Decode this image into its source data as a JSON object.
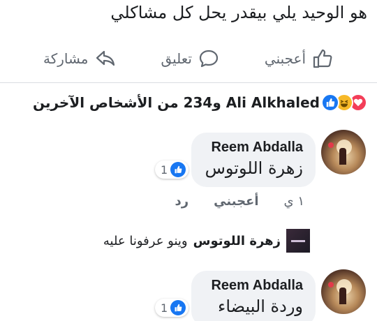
{
  "post": {
    "text": "هو الوحيد يلي بيقدر يحل كل مشاكلي"
  },
  "actions": {
    "like": "أعجبني",
    "comment": "تعليق",
    "share": "مشاركة"
  },
  "reactions": {
    "summary": "Ali Alkhaled و234 من الأشخاص الآخرين"
  },
  "comments": [
    {
      "author": "Reem Abdalla",
      "text": "زهرة اللوتوس",
      "like_count": "1",
      "time": "١ ي",
      "like_action": "أعجبني",
      "reply_action": "رد"
    },
    {
      "author": "Reem Abdalla",
      "text": "وردة البيضاء",
      "like_count": "1"
    }
  ],
  "reply_preview": {
    "name": "زهرة اللوتوس",
    "text": "وينو عرفونا عليه"
  },
  "colors": {
    "accent": "#1877f2",
    "muted": "#606770",
    "bubble": "#f0f2f5"
  }
}
